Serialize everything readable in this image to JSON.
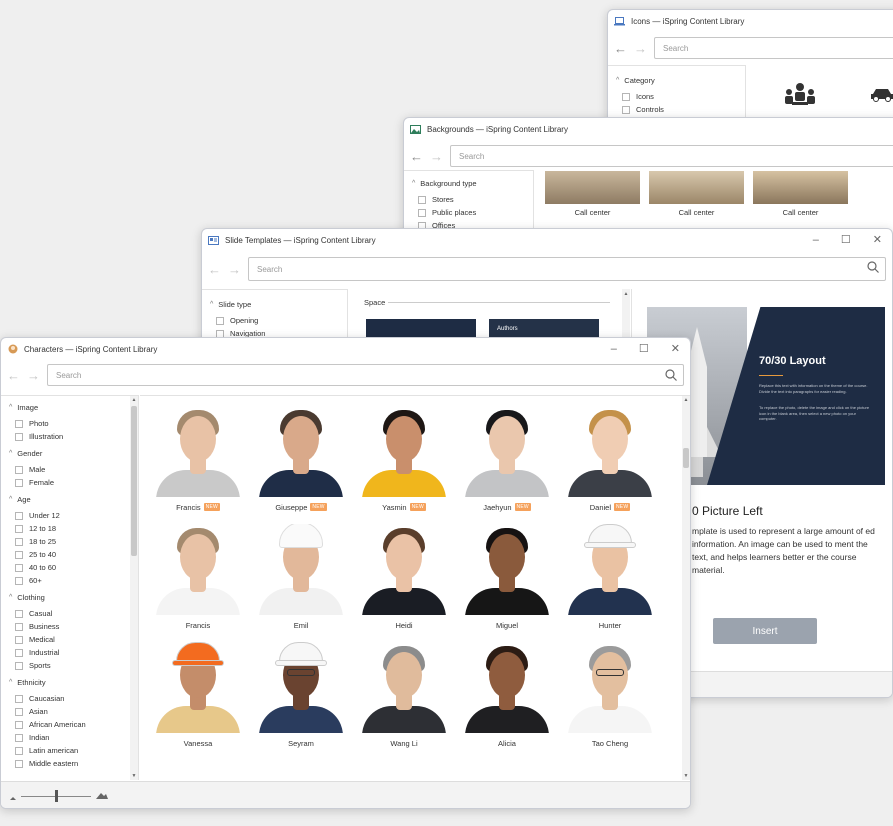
{
  "icons_window": {
    "title": "Icons — iSpring Content Library",
    "search_placeholder": "Search",
    "sidebar": {
      "group": "Category",
      "items": [
        "Icons",
        "Controls"
      ]
    }
  },
  "backgrounds_window": {
    "title": "Backgrounds — iSpring Content Library",
    "search_placeholder": "Search",
    "sidebar": {
      "group": "Background type",
      "items": [
        "Stores",
        "Public places",
        "Offices"
      ]
    },
    "thumbs": [
      "Call center",
      "Call center",
      "Call center"
    ]
  },
  "templates_window": {
    "title": "Slide Templates — iSpring Content Library",
    "search_placeholder": "Search",
    "sidebar": {
      "group": "Slide type",
      "items": [
        "Opening",
        "Navigation"
      ]
    },
    "section_label": "Space",
    "thumb_label": "Authors",
    "preview": {
      "slide_title": "70/30 Layout",
      "slide_body": "Replace this text with information on the theme of the course. Divide the text into paragraphs for easier reading.",
      "slide_body2": "To replace the photo, delete the image and click on the picture icon in the blank area, then select a new photo on your computer.",
      "heading": "0 Picture Left",
      "description": "mplate is used to represent a large amount of ed information. An image can be used to ment the text, and helps learners better er the course material.",
      "insert_label": "Insert"
    }
  },
  "characters_window": {
    "title": "Characters — iSpring Content Library",
    "search_placeholder": "Search",
    "filters": [
      {
        "label": "Image",
        "options": [
          "Photo",
          "Illustration"
        ]
      },
      {
        "label": "Gender",
        "options": [
          "Male",
          "Female"
        ]
      },
      {
        "label": "Age",
        "options": [
          "Under 12",
          "12 to 18",
          "18 to 25",
          "25 to 40",
          "40 to 60",
          "60+"
        ]
      },
      {
        "label": "Clothing",
        "options": [
          "Casual",
          "Business",
          "Medical",
          "Industrial",
          "Sports"
        ]
      },
      {
        "label": "Ethnicity",
        "options": [
          "Caucasian",
          "Asian",
          "African American",
          "Indian",
          "Latin american",
          "Middle eastern"
        ]
      }
    ],
    "new_badge": "NEW",
    "characters": [
      {
        "name": "Francis",
        "is_new": true,
        "skin": "#e8c2a6",
        "hair": "#a48a6e",
        "top": "#c9c9c9"
      },
      {
        "name": "Giuseppe",
        "is_new": true,
        "skin": "#d9a98a",
        "hair": "#4a3a30",
        "top": "#1f2d47"
      },
      {
        "name": "Yasmin",
        "is_new": true,
        "skin": "#c98f6c",
        "hair": "#1e1714",
        "top": "#f0b61c"
      },
      {
        "name": "Jaehyun",
        "is_new": true,
        "skin": "#eac7ad",
        "hair": "#18181a",
        "top": "#c3c4c6"
      },
      {
        "name": "Daniel",
        "is_new": true,
        "skin": "#f0cdb3",
        "hair": "#c4914a",
        "top": "#3b3f47"
      },
      {
        "name": "Francis",
        "is_new": false,
        "skin": "#e8c2a6",
        "hair": "#a48a6e",
        "top": "#f4f4f4"
      },
      {
        "name": "Emil",
        "is_new": false,
        "skin": "#e2b89a",
        "hair": "#ffffff",
        "top": "#f1f1f1",
        "hat": "chef"
      },
      {
        "name": "Heidi",
        "is_new": false,
        "skin": "#eac2a6",
        "hair": "#5a3e2b",
        "top": "#1a1d24"
      },
      {
        "name": "Miguel",
        "is_new": false,
        "skin": "#8a5a3c",
        "hair": "#161212",
        "top": "#161616"
      },
      {
        "name": "Hunter",
        "is_new": false,
        "skin": "#eac2a3",
        "hair": "#ffffff",
        "top": "#22324f",
        "hat": "hard-white"
      },
      {
        "name": "Vanessa",
        "is_new": false,
        "skin": "#c48d6a",
        "hair": "#f36b1f",
        "top": "#e7c88a",
        "hat": "hard-orange"
      },
      {
        "name": "Seyram",
        "is_new": false,
        "skin": "#6a4330",
        "hair": "#ffffff",
        "top": "#2a3c5e",
        "hat": "hard-white",
        "glasses": true
      },
      {
        "name": "Wang Li",
        "is_new": false,
        "skin": "#e0bb9c",
        "hair": "#8c8c8c",
        "top": "#2d2f34"
      },
      {
        "name": "Alicia",
        "is_new": false,
        "skin": "#8f5c3e",
        "hair": "#2c1c14",
        "top": "#1f1f22"
      },
      {
        "name": "Tao Cheng",
        "is_new": false,
        "skin": "#e3bf9f",
        "hair": "#9b9b9b",
        "top": "#f5f5f5",
        "glasses": true
      }
    ]
  },
  "colors": {
    "accent_button": "#9ba3ae",
    "slide_bg": "#1e2c44",
    "new_badge": "#f5a15b"
  }
}
